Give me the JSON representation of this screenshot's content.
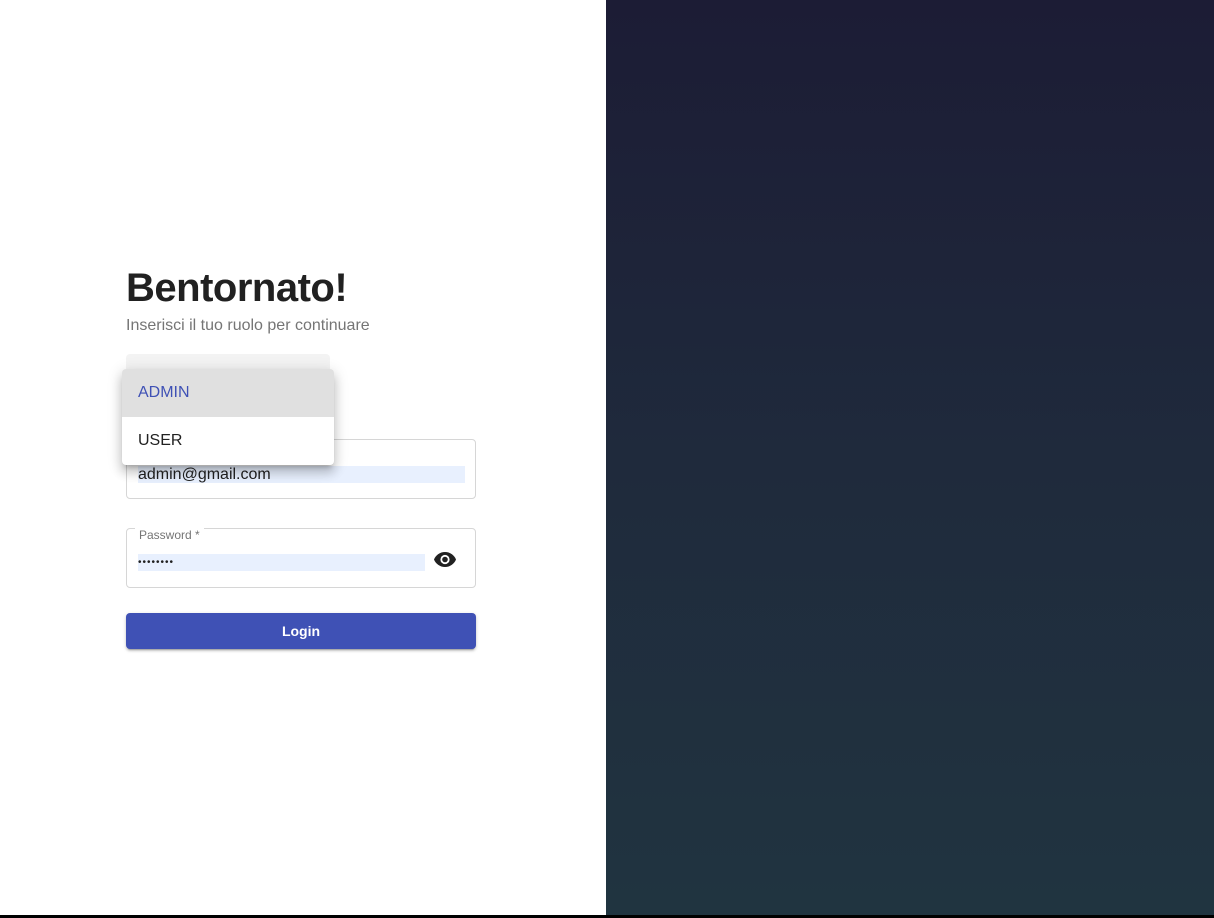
{
  "login": {
    "title": "Bentornato!",
    "subtitle": "Inserisci il tuo ruolo per continuare",
    "role_options": [
      {
        "label": "ADMIN",
        "selected": true
      },
      {
        "label": "USER",
        "selected": false
      }
    ],
    "email": {
      "value": "admin@gmail.com"
    },
    "password": {
      "label": "Password *",
      "masked_value": "••••••••"
    },
    "login_button": "Login"
  },
  "icons": {
    "password_toggle": "eye-icon"
  },
  "colors": {
    "accent": "#3f51b5",
    "panel_gradient_top": "#1c1c35",
    "panel_gradient_bottom": "#203440",
    "autofill": "#e8f0fe"
  }
}
